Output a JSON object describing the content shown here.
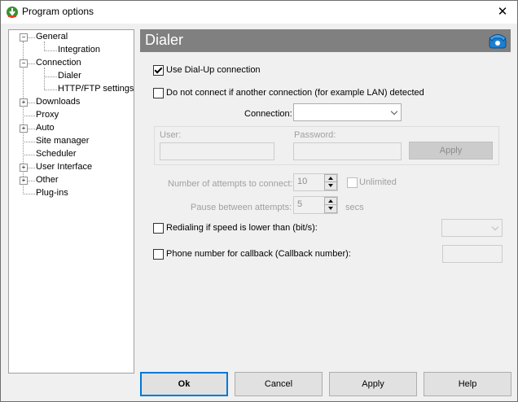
{
  "window": {
    "title": "Program options",
    "close_label": "✕"
  },
  "tree": {
    "items": [
      {
        "label": "General",
        "expander": "−"
      },
      {
        "label": "Integration"
      },
      {
        "label": "Connection",
        "expander": "−"
      },
      {
        "label": "Dialer"
      },
      {
        "label": "HTTP/FTP settings"
      },
      {
        "label": "Downloads",
        "expander": "+"
      },
      {
        "label": "Proxy"
      },
      {
        "label": "Auto",
        "expander": "+"
      },
      {
        "label": "Site manager"
      },
      {
        "label": "Scheduler"
      },
      {
        "label": "User Interface",
        "expander": "+"
      },
      {
        "label": "Other",
        "expander": "+"
      },
      {
        "label": "Plug-ins"
      }
    ],
    "selected": "Dialer"
  },
  "panel": {
    "title": "Dialer"
  },
  "dialer": {
    "use_dialup": {
      "label": "Use Dial-Up connection",
      "checked": true
    },
    "no_connect": {
      "label": "Do not connect if another connection (for example LAN) detected",
      "checked": false
    },
    "connection_label": "Connection:",
    "connection_value": "",
    "user_label": "User:",
    "user_value": "",
    "password_label": "Password:",
    "password_value": "",
    "apply_small": "Apply",
    "attempts_label": "Number of attempts to connect:",
    "attempts_value": "10",
    "unlimited_label": "Unlimited",
    "pause_label": "Pause between attempts:",
    "pause_value": "5",
    "pause_unit": "secs",
    "redial": {
      "label": "Redialing if speed is lower than (bit/s):",
      "checked": false
    },
    "redial_value": "",
    "callback": {
      "label": "Phone number for callback (Callback number):",
      "checked": false
    },
    "callback_value": ""
  },
  "buttons": {
    "ok": "Ok",
    "cancel": "Cancel",
    "apply": "Apply",
    "help": "Help"
  },
  "colors": {
    "accent": "#0078d7",
    "header_bg": "#808080",
    "selection": "#ffffff"
  }
}
